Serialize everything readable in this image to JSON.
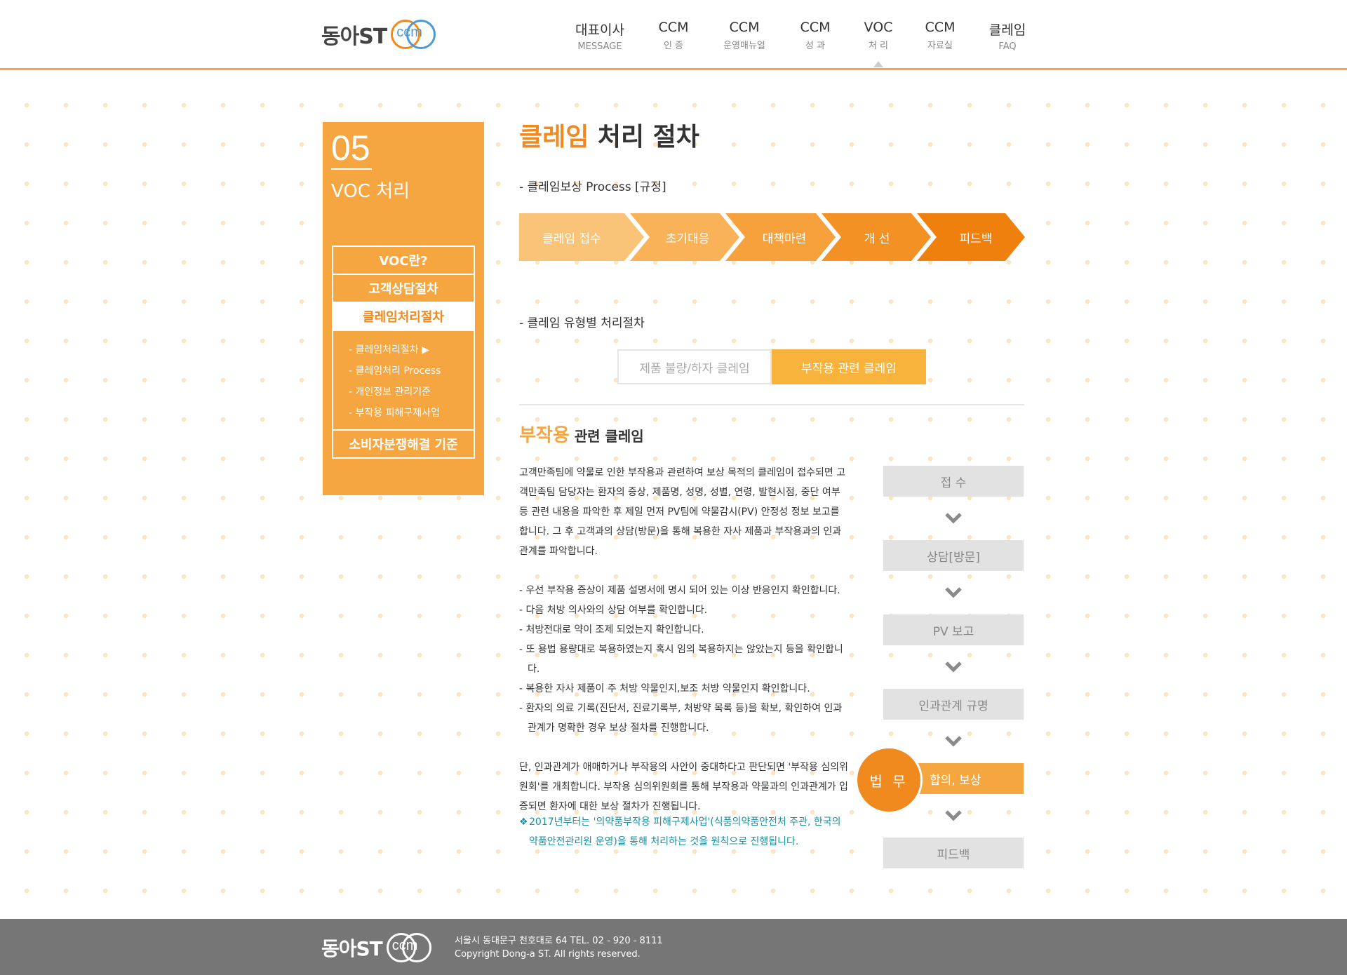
{
  "brand": {
    "name": "동아ST",
    "mark": "ccm"
  },
  "nav": [
    {
      "ko": "대표이사",
      "sub": "MESSAGE"
    },
    {
      "ko": "CCM",
      "sub": "인 증"
    },
    {
      "ko": "CCM",
      "sub": "운영매뉴얼"
    },
    {
      "ko": "CCM",
      "sub": "성 과"
    },
    {
      "ko": "VOC",
      "sub": "처 리"
    },
    {
      "ko": "CCM",
      "sub": "자료실"
    },
    {
      "ko": "클레임",
      "sub": "FAQ"
    }
  ],
  "sidebar": {
    "number": "05",
    "title": "VOC 처리",
    "items": [
      "VOC란?",
      "고객상담절차",
      "클레임처리절차"
    ],
    "subitems": [
      "- 클레임처리절차 ▶",
      "- 클레임처리 Process",
      "- 개인정보 관리기준",
      "- 부작용 피해구제사업"
    ],
    "last": "소비자분쟁해결 기준"
  },
  "page": {
    "title_hl": "클레임",
    "title_rest": " 처리 절차",
    "section1": "- 클레임보상 Process [규정]",
    "section2": "- 클레임 유형별 처리절차"
  },
  "process_steps": [
    "클레임 접수",
    "초기대응",
    "대책마련",
    "개 선",
    "피드백"
  ],
  "colors": {
    "step": [
      "#fac478",
      "#f9b257",
      "#f7a13c",
      "#f39124",
      "#ef800d"
    ],
    "accent": "#f08a1e",
    "note": "#1b8fa3"
  },
  "tabs": [
    "제품 불량/하자 클레임",
    "부작용 관련 클레임"
  ],
  "subsection": {
    "hl": "부작용",
    "rest": " 관련 클레임"
  },
  "desc": {
    "p1": "고객만족팀에 약물로 인한 부작용과 관련하여 보상 목적의 클레임이 접수되면 고객만족팀 담당자는 환자의 증상, 제품명, 성명, 성별, 연령, 발현시점, 중단 여부 등 관련 내용을 파악한 후 제일 먼저 PV팀에 약물감시(PV) 안정성 정보 보고를 합니다. 그 후 고객과의 상담(방문)을 통해 복용한 자사 제품과 부작용과의 인과 관계를 파악합니다.",
    "list": [
      "- 우선 부작용 증상이 제품 설명서에 명시 되어 있는 이상 반응인지 확인합니다.",
      "- 다음 처방 의사와의 상담 여부를 확인합니다.",
      "- 처방전대로 약이 조제 되었는지 확인합니다.",
      "- 또 용법 용량대로 복용하였는지 혹시 임의 복용하지는 않았는지 등을 확인합니다.",
      "- 복용한 자사 제품이 주 처방 약물인지,보조 처방 약물인지 확인합니다.",
      "- 환자의 의료 기록(진단서, 진료기록부, 처방약 목록 등)을 확보, 확인하여 인과 관계가 명확한 경우 보상 절차를 진행합니다."
    ],
    "p2": "단, 인과관계가 애매하거나 부작용의 사안이 중대하다고 판단되면 '부작용 심의위원회'를 개최합니다. 부작용 심의위원회를 통해 부작용과 약물과의 인과관계가 입증되면 환자에 대한 보상 절차가 진행됩니다."
  },
  "note": {
    "mark": "❖",
    "text": "2017년부터는 '의약품부작용 피해구제사업'(식품의약품안전처 주관, 한국의약품안전관리원 운영)을 통해 처리하는 것을 원칙으로 진행됩니다."
  },
  "flow": [
    "접 수",
    "상담[방문]",
    "PV 보고",
    "인과관계 규명",
    "합의, 보상",
    "피드백"
  ],
  "law": "법 무",
  "footer": {
    "address": "서울시 동대문구 천호대로 64 TEL. 02 - 920 - 8111",
    "copyright": "Copyright Dong-a ST. All rights reserved."
  }
}
